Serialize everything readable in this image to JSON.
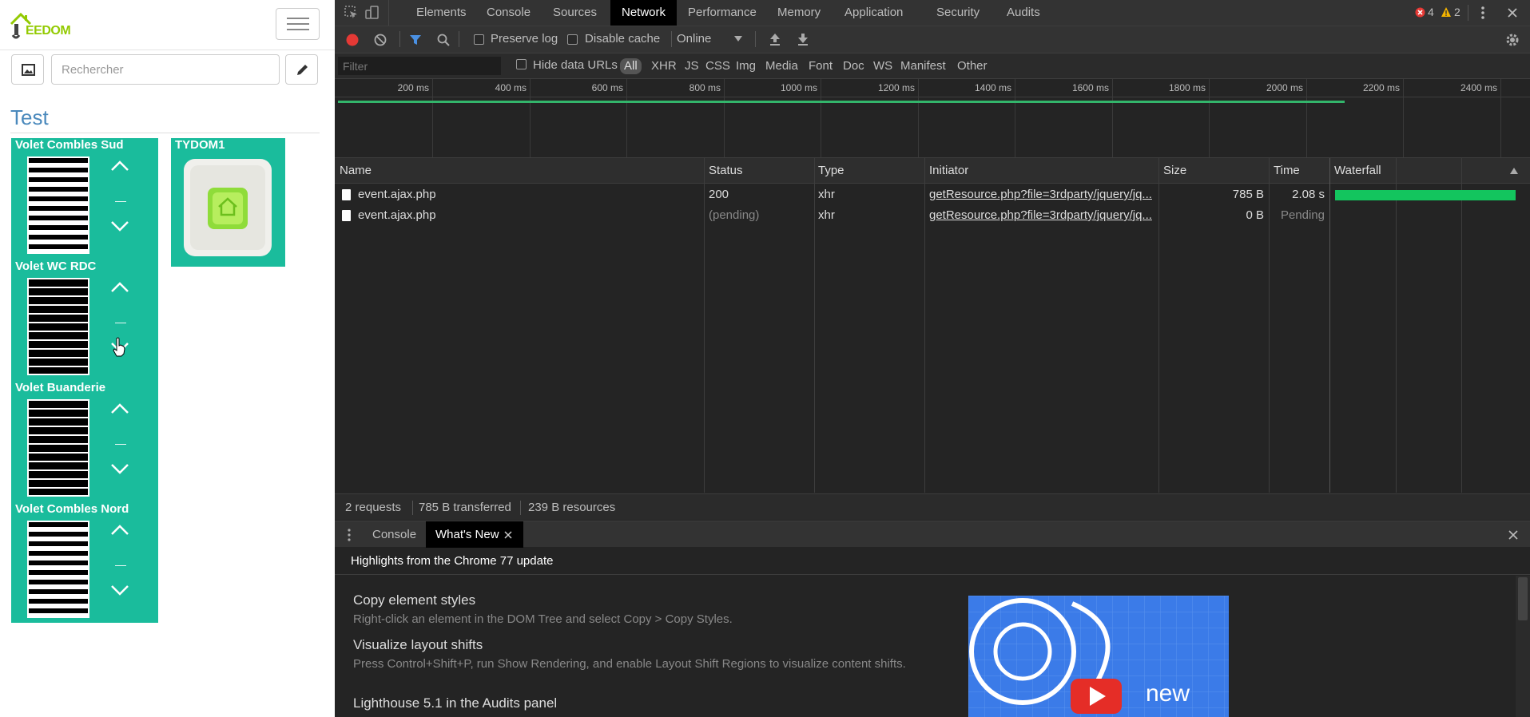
{
  "app": {
    "logo_text": "EEDOM",
    "search_placeholder": "Rechercher",
    "object_title": "Test",
    "shutters": [
      {
        "name": "Volet Combles Sud",
        "state": "open"
      },
      {
        "name": "Volet WC RDC",
        "state": "closed"
      },
      {
        "name": "Volet Buanderie",
        "state": "closed"
      },
      {
        "name": "Volet Combles Nord",
        "state": "open"
      }
    ],
    "tydom": {
      "name": "TYDOM1"
    }
  },
  "devtools": {
    "tabs": [
      "Elements",
      "Console",
      "Sources",
      "Network",
      "Performance",
      "Memory",
      "Application",
      "Security",
      "Audits"
    ],
    "active_tab": "Network",
    "error_count": "4",
    "warning_count": "2",
    "toolbar": {
      "preserve_log": "Preserve log",
      "disable_cache": "Disable cache",
      "throttling": "Online"
    },
    "filter": {
      "placeholder": "Filter",
      "hide_data_urls": "Hide data URLs",
      "types": [
        "All",
        "XHR",
        "JS",
        "CSS",
        "Img",
        "Media",
        "Font",
        "Doc",
        "WS",
        "Manifest",
        "Other"
      ]
    },
    "timeline_ticks": [
      "200 ms",
      "400 ms",
      "600 ms",
      "800 ms",
      "1000 ms",
      "1200 ms",
      "1400 ms",
      "1600 ms",
      "1800 ms",
      "2000 ms",
      "2200 ms",
      "2400 ms"
    ],
    "columns": [
      "Name",
      "Status",
      "Type",
      "Initiator",
      "Size",
      "Time",
      "Waterfall"
    ],
    "requests": [
      {
        "name": "event.ajax.php",
        "status": "200",
        "type": "xhr",
        "initiator": "getResource.php?file=3rdparty/jquery/jq...",
        "size": "785 B",
        "time": "2.08 s"
      },
      {
        "name": "event.ajax.php",
        "status": "(pending)",
        "type": "xhr",
        "initiator": "getResource.php?file=3rdparty/jquery/jq...",
        "size": "0 B",
        "time": "Pending"
      }
    ],
    "status": {
      "requests": "2 requests",
      "transferred": "785 B transferred",
      "resources": "239 B resources"
    },
    "drawer_tabs": [
      "Console",
      "What's New"
    ],
    "whats_new": {
      "title": "Highlights from the Chrome 77 update",
      "items": [
        {
          "heading": "Copy element styles",
          "text": "Right-click an element in the DOM Tree and select Copy > Copy Styles."
        },
        {
          "heading": "Visualize layout shifts",
          "text": "Press Control+Shift+P, run Show Rendering, and enable Layout Shift Regions to visualize content shifts."
        },
        {
          "heading": "Lighthouse 5.1 in the Audits panel",
          "text": ""
        }
      ],
      "video_label": "new"
    }
  }
}
